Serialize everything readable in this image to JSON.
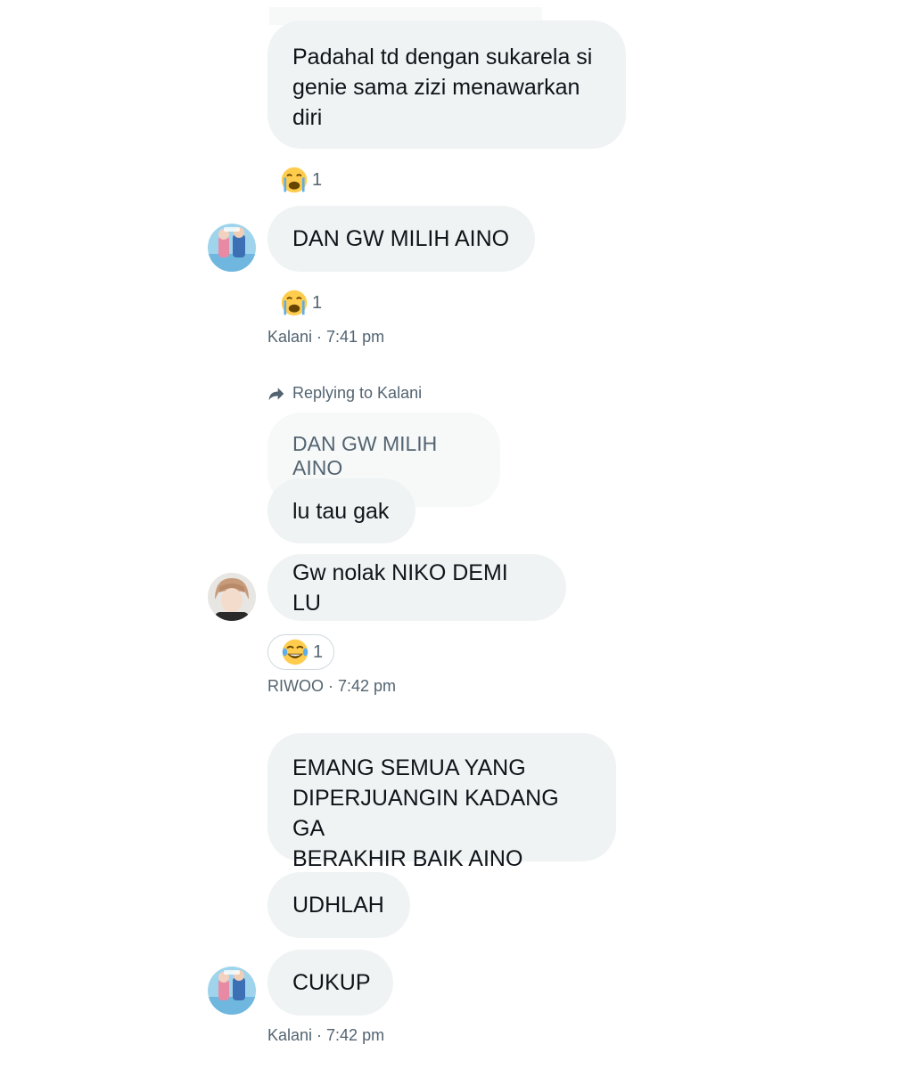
{
  "messages": {
    "m1": {
      "text": "Padahal td dengan sukarela si\ngenie sama zizi menawarkan\ndiri",
      "reaction_count": "1"
    },
    "m2": {
      "text": "DAN GW MILIH AINO",
      "reaction_count": "1",
      "meta": "Kalani · 7:41 pm"
    },
    "reply": {
      "label": "Replying to Kalani",
      "quoted": "DAN GW MILIH AINO"
    },
    "m3": {
      "text": "lu tau gak"
    },
    "m4": {
      "text": "Gw nolak NIKO DEMI LU",
      "reaction_count": "1",
      "meta": "RIWOO · 7:42 pm"
    },
    "m5": {
      "text": "EMANG SEMUA YANG\nDIPERJUANGIN KADANG GA\nBERAKHIR BAIK AINO"
    },
    "m6": {
      "text": "UDHLAH"
    },
    "m7": {
      "text": "CUKUP",
      "meta": "Kalani · 7:42 pm"
    }
  },
  "icons": {
    "crying": "loudly-crying-face-icon",
    "laughing": "tears-of-joy-face-icon",
    "reply": "reply-arrow-icon"
  },
  "colors": {
    "bubble": "#eff3f4",
    "quoted_bubble": "#f7f9f9",
    "meta_text": "#536471",
    "emoji_yellow": "#ffcc4d",
    "tear_blue": "#5dadec"
  }
}
